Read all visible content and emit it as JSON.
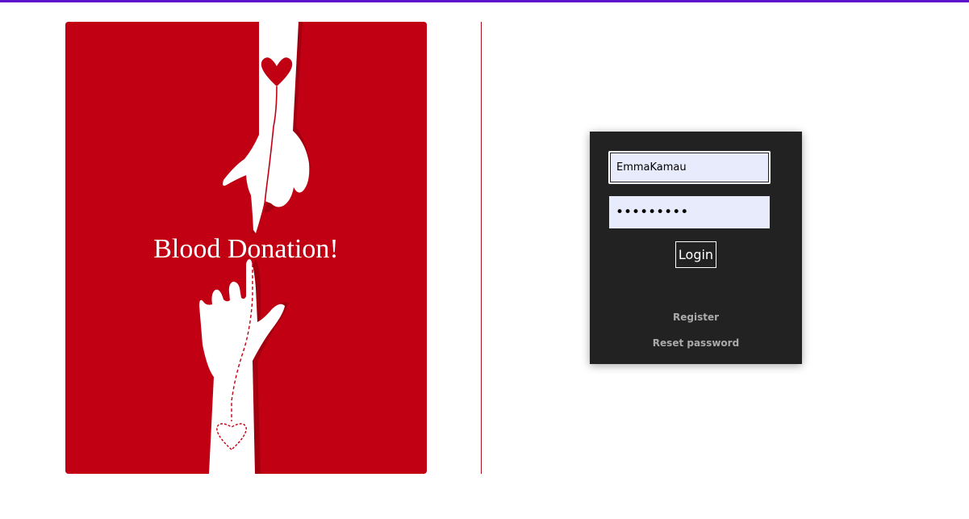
{
  "accent_color": "#5b0ec9",
  "poster": {
    "title": "Blood Donation!",
    "background_color": "#c20013"
  },
  "login": {
    "username_value": "EmmaKamau",
    "password_value": "•••••••••",
    "login_label": "Login",
    "register_label": "Register",
    "reset_label": "Reset password"
  }
}
